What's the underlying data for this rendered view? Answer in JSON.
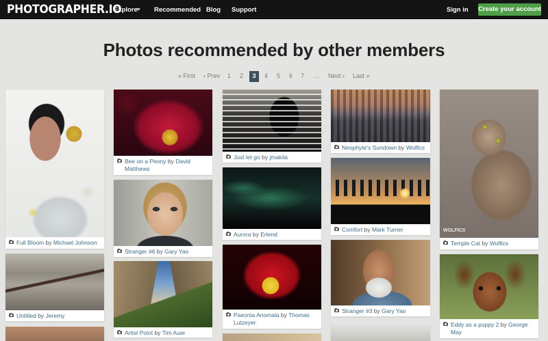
{
  "nav": {
    "logo": "PHOTOGRAPHER.IO",
    "explore": "Explore",
    "recommended": "Recommended",
    "blog": "Blog",
    "support": "Support",
    "signin": "Sign in",
    "create_account": "Create your account"
  },
  "page_title": "Photos recommended by other members",
  "pagination": {
    "first": "« First",
    "prev": "‹ Prev",
    "pages": [
      "1",
      "2",
      "3",
      "4",
      "5",
      "6",
      "7"
    ],
    "current": "3",
    "ellipsis": "…",
    "next": "Next ›",
    "last": "Last »"
  },
  "photos": [
    {
      "title": "Full Bloom",
      "by": "by",
      "author": "Michael Johnson"
    },
    {
      "title": "Untitled",
      "by": "by",
      "author": "Jeremy"
    },
    {
      "title": "Bee on a Peony",
      "by": "by",
      "author": "David Matthews"
    },
    {
      "title": "Stranger #6",
      "by": "by",
      "author": "Gary Yao"
    },
    {
      "title": "Artist Point",
      "by": "by",
      "author": "Tim Auer"
    },
    {
      "title": "Just let go",
      "by": "by",
      "author": "jmakila"
    },
    {
      "title": "Aurora",
      "by": "by",
      "author": "Erlend"
    },
    {
      "title": "Paeonia Anomala",
      "by": "by",
      "author": "Thomas Lutzeyer"
    },
    {
      "title": "Neophyte's Sundown",
      "by": "by",
      "author": "Wolfics"
    },
    {
      "title": "Comfort",
      "by": "by",
      "author": "Mark Turner"
    },
    {
      "title": "Stranger #3",
      "by": "by",
      "author": "Gary Yao"
    },
    {
      "title": "Temple Cat",
      "by": "by",
      "author": "Wolfics"
    },
    {
      "title": "Eddy as a puppy 2",
      "by": "by",
      "author": "George May"
    }
  ],
  "watermark": "WOLFICS"
}
